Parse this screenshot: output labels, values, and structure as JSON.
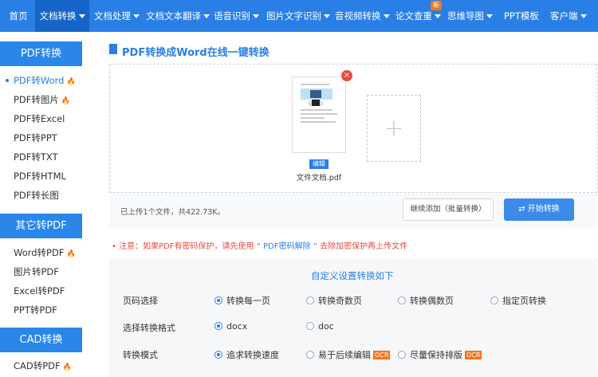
{
  "nav": {
    "items": [
      {
        "label": "首页",
        "dropdown": false
      },
      {
        "label": "文档转换",
        "dropdown": true,
        "active": true
      },
      {
        "label": "文档处理",
        "dropdown": true
      },
      {
        "label": "文档文本翻译",
        "dropdown": true
      },
      {
        "label": "语音识别",
        "dropdown": true
      },
      {
        "label": "图片文字识别",
        "dropdown": true
      },
      {
        "label": "音视频转换",
        "dropdown": true
      },
      {
        "label": "论文查重",
        "dropdown": true
      },
      {
        "label": "思维导图",
        "dropdown": true
      },
      {
        "label": "PPT模板",
        "dropdown": false
      },
      {
        "label": "客户端",
        "dropdown": true
      }
    ],
    "new_badge": "新"
  },
  "sidebar": {
    "groups": [
      {
        "title": "PDF转换",
        "items": [
          {
            "label": "PDF转Word",
            "hot": true,
            "active": true
          },
          {
            "label": "PDF转图片",
            "hot": true
          },
          {
            "label": "PDF转Excel"
          },
          {
            "label": "PDF转PPT"
          },
          {
            "label": "PDF转TXT"
          },
          {
            "label": "PDF转HTML"
          },
          {
            "label": "PDF转长图"
          }
        ]
      },
      {
        "title": "其它转PDF",
        "items": [
          {
            "label": "Word转PDF",
            "hot": true
          },
          {
            "label": "图片转PDF"
          },
          {
            "label": "Excel转PDF"
          },
          {
            "label": "PPT转PDF"
          }
        ]
      },
      {
        "title": "CAD转换",
        "items": [
          {
            "label": "CAD转PDF",
            "hot": true
          }
        ]
      }
    ]
  },
  "main": {
    "title": "PDF转换成Word在线一键转换",
    "file": {
      "name": "文件文档.pdf",
      "edit_label": "编辑"
    },
    "status_text": "已上传1个文件，共422.73K。",
    "continue_button": "继续添加（批量转换）",
    "start_button": "开始转换",
    "notice": {
      "prefix": "注意：如果PDF有密码保护，请先使用",
      "link": "“ PDF密码解除 ”",
      "suffix": "去除加密保护再上传文件"
    },
    "settings": {
      "title": "自定义设置转换如下",
      "rows": [
        {
          "label": "页码选择",
          "options": [
            {
              "label": "转换每一页",
              "selected": true
            },
            {
              "label": "转换奇数页"
            },
            {
              "label": "转换偶数页"
            },
            {
              "label": "指定页转换"
            }
          ]
        },
        {
          "label": "选择转换格式",
          "options": [
            {
              "label": "docx",
              "selected": true
            },
            {
              "label": "doc"
            }
          ]
        },
        {
          "label": "转换模式",
          "options": [
            {
              "label": "追求转换速度",
              "selected": true
            },
            {
              "label": "易于后续编辑",
              "ocr": "OCR"
            },
            {
              "label": "尽量保持排版",
              "ocr": "OCR"
            }
          ]
        }
      ]
    }
  },
  "colors": {
    "primary": "#2a7fe6",
    "danger": "#e94b3c",
    "hot": "#f46a2a",
    "badge": "#f5761a"
  }
}
